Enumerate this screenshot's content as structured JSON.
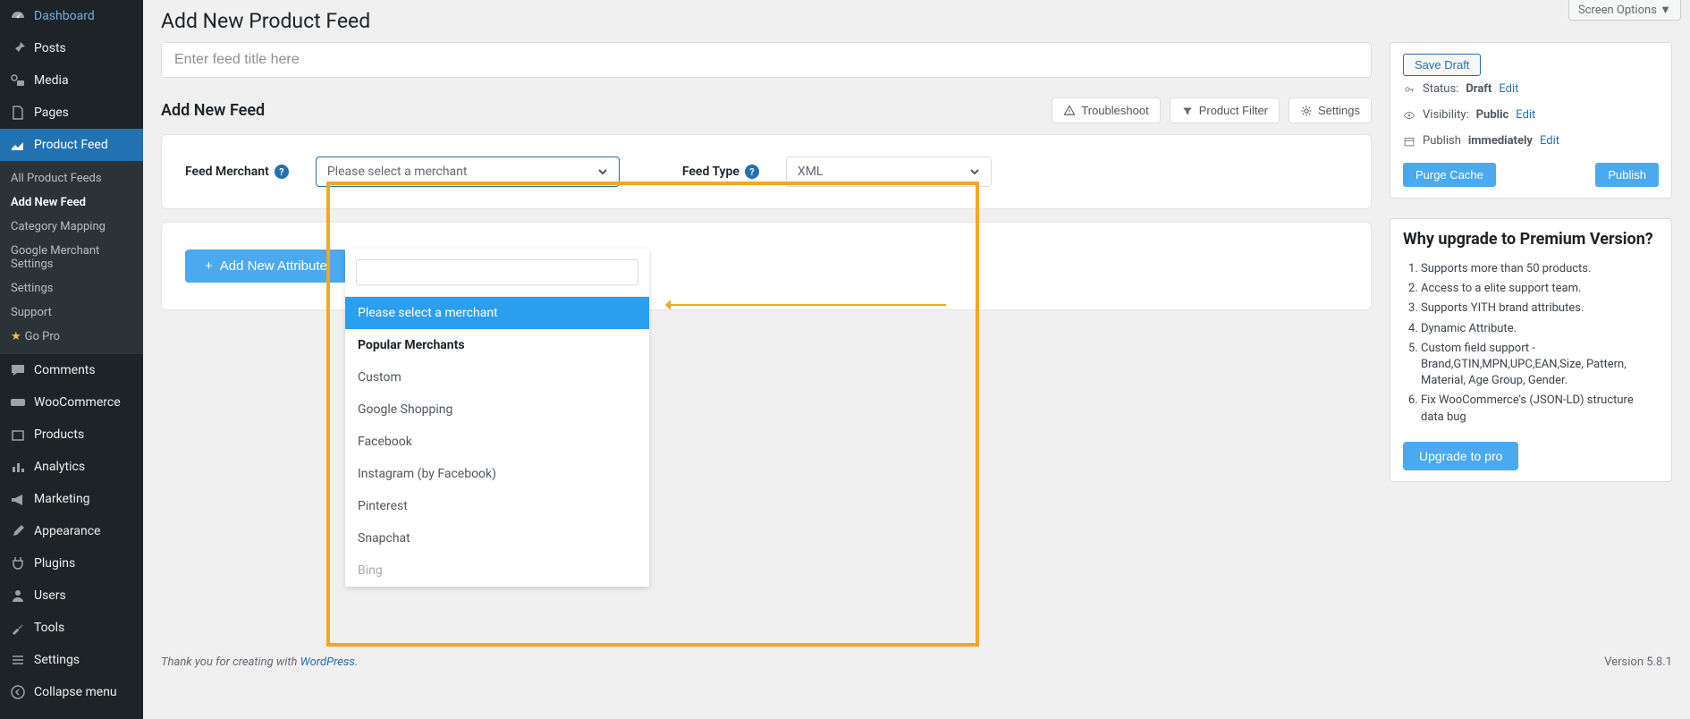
{
  "screen_options": "Screen Options ▼",
  "sidebar": {
    "items": [
      {
        "label": "Dashboard",
        "icon": "gauge"
      },
      {
        "label": "Posts",
        "icon": "pin"
      },
      {
        "label": "Media",
        "icon": "media"
      },
      {
        "label": "Pages",
        "icon": "pages"
      },
      {
        "label": "Product Feed",
        "icon": "chart",
        "current": true
      },
      {
        "label": "Comments",
        "icon": "comment"
      },
      {
        "label": "WooCommerce",
        "icon": "woo"
      },
      {
        "label": "Products",
        "icon": "products"
      },
      {
        "label": "Analytics",
        "icon": "analytics"
      },
      {
        "label": "Marketing",
        "icon": "megaphone"
      },
      {
        "label": "Appearance",
        "icon": "brush"
      },
      {
        "label": "Plugins",
        "icon": "plug"
      },
      {
        "label": "Users",
        "icon": "user"
      },
      {
        "label": "Tools",
        "icon": "wrench"
      },
      {
        "label": "Settings",
        "icon": "sliders"
      },
      {
        "label": "Collapse menu",
        "icon": "collapse"
      }
    ],
    "sub": {
      "items": [
        {
          "label": "All Product Feeds"
        },
        {
          "label": "Add New Feed",
          "active": true
        },
        {
          "label": "Category Mapping"
        },
        {
          "label": "Google Merchant Settings"
        },
        {
          "label": "Settings"
        },
        {
          "label": "Support"
        },
        {
          "label": "Go Pro",
          "star": true
        }
      ]
    }
  },
  "page_title": "Add New Product Feed",
  "title_placeholder": "Enter feed title here",
  "section": {
    "title": "Add New Feed",
    "buttons": {
      "troubleshoot": "Troubleshoot",
      "product_filter": "Product Filter",
      "settings": "Settings"
    }
  },
  "form": {
    "merchant_label": "Feed Merchant",
    "merchant_placeholder": "Please select a merchant",
    "feed_type_label": "Feed Type",
    "feed_type_value": "XML"
  },
  "dropdown": {
    "placeholder": "Please select a merchant",
    "group_header": "Popular Merchants",
    "options": [
      "Custom",
      "Google Shopping",
      "Facebook",
      "Instagram (by Facebook)",
      "Pinterest",
      "Snapchat",
      "Bing"
    ]
  },
  "add_attr_button": "Add New Attribute",
  "publish_box": {
    "save_draft": "Save Draft",
    "status_label": "Status:",
    "status_value": "Draft",
    "visibility_label": "Visibility:",
    "visibility_value": "Public",
    "publish_label_prefix": "Publish",
    "publish_value": "immediately",
    "edit": "Edit",
    "purge": "Purge Cache",
    "publish": "Publish"
  },
  "upgrade": {
    "title": "Why upgrade to Premium Version?",
    "items": [
      "Supports more than 50 products.",
      "Access to a elite support team.",
      "Supports YITH brand attributes.",
      "Dynamic Attribute.",
      "Custom field support - Brand,GTIN,MPN,UPC,EAN,Size, Pattern, Material, Age Group, Gender.",
      "Fix WooCommerce's (JSON-LD) structure data bug"
    ],
    "button": "Upgrade to pro"
  },
  "footer": {
    "thanks_prefix": "Thank you for creating with ",
    "wp": "WordPress",
    "version": "Version 5.8.1"
  }
}
